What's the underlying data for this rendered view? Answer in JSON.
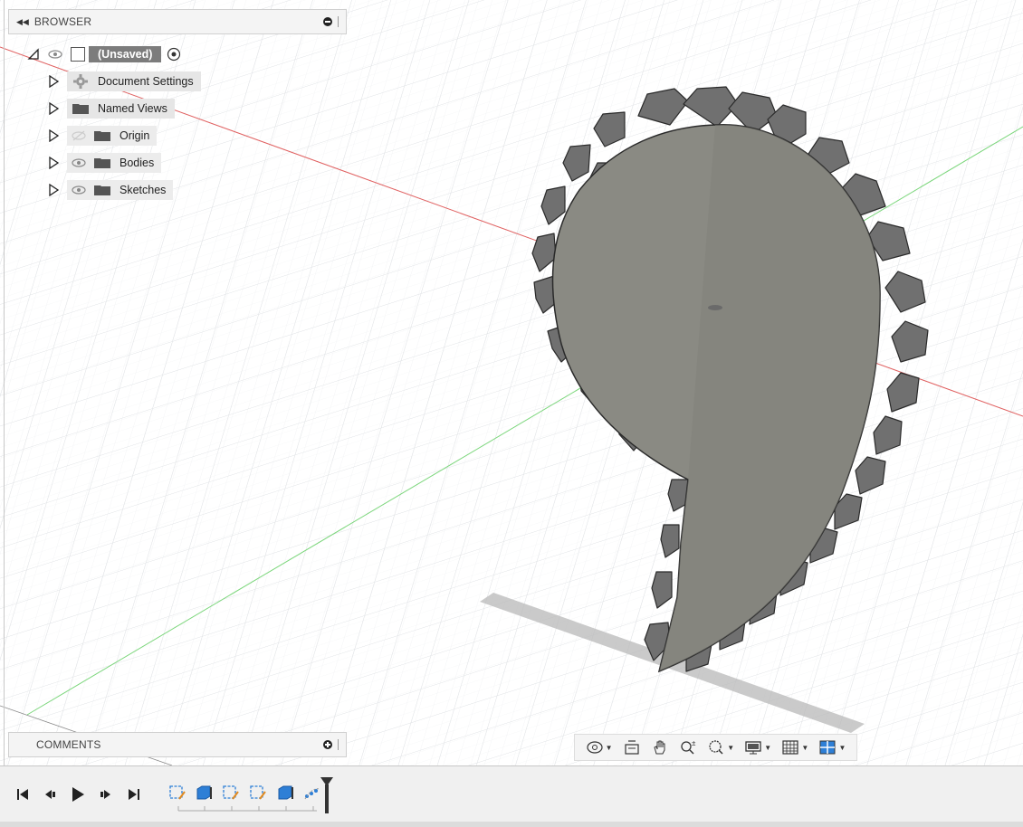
{
  "browser": {
    "title": "BROWSER",
    "root_label": "(Unsaved)",
    "items": [
      {
        "label": "Document Settings"
      },
      {
        "label": "Named Views"
      },
      {
        "label": "Origin"
      },
      {
        "label": "Bodies"
      },
      {
        "label": "Sketches"
      }
    ]
  },
  "comments": {
    "title": "COMMENTS"
  },
  "nav_toolbar": {
    "tools": [
      "orbit-icon",
      "look-at-icon",
      "pan-icon",
      "zoom-icon",
      "fit-icon",
      "display-settings-icon",
      "grid-settings-icon",
      "viewports-icon"
    ]
  },
  "timeline": {
    "controls": [
      "go-to-start-icon",
      "step-back-icon",
      "play-icon",
      "step-forward-icon",
      "go-to-end-icon"
    ],
    "features": [
      "sketch-feature-icon",
      "extrude-feature-icon",
      "sketch-feature-icon",
      "sketch-feature-icon",
      "extrude-feature-icon",
      "pattern-feature-icon"
    ]
  },
  "colors": {
    "body_face": "#8a8a82",
    "body_tooth": "#6f6f6a",
    "x_axis": "#e06060",
    "y_axis": "#7bd67b",
    "grid": "#d6d9dc",
    "accent_blue": "#2e7fd6"
  }
}
